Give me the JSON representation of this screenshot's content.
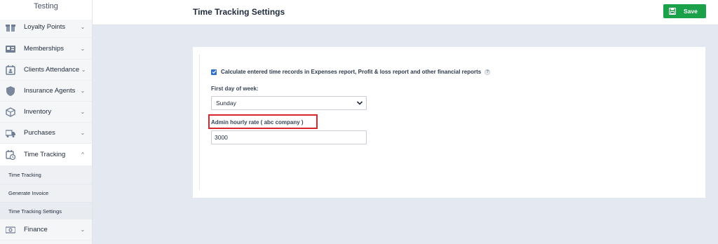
{
  "sidebar": {
    "title": "Testing",
    "items": [
      {
        "label": "Loyalty Points",
        "icon": "gift-icon",
        "chevron": "⌄"
      },
      {
        "label": "Memberships",
        "icon": "id-card-icon",
        "chevron": "⌄"
      },
      {
        "label": "Clients Attendance",
        "icon": "calendar-user-icon",
        "chevron": "⌄"
      },
      {
        "label": "Insurance Agents",
        "icon": "shield-icon",
        "chevron": "⌄"
      },
      {
        "label": "Inventory",
        "icon": "box-icon",
        "chevron": "⌄"
      },
      {
        "label": "Purchases",
        "icon": "truck-icon",
        "chevron": "⌄"
      },
      {
        "label": "Time Tracking",
        "icon": "calendar-clock-icon",
        "chevron": "^"
      },
      {
        "label": "Finance",
        "icon": "money-icon",
        "chevron": "⌄"
      }
    ],
    "subitems": [
      {
        "label": "Time Tracking"
      },
      {
        "label": "Generate Invoice"
      },
      {
        "label": "Time Tracking Settings"
      }
    ]
  },
  "header": {
    "title": "Time Tracking Settings",
    "save_label": "Save",
    "save_color": "#1aa14a"
  },
  "form": {
    "checkbox_label": "Calculate entered time records in Expenses report, Profit & loss report and other financial reports",
    "checkbox_checked": true,
    "help_glyph": "?",
    "first_day_label": "First day of week:",
    "first_day_value": "Sunday",
    "hourly_rate_label": "Admin hourly rate ( abc company )",
    "hourly_rate_value": "3000",
    "highlight_color": "#d7262c"
  }
}
